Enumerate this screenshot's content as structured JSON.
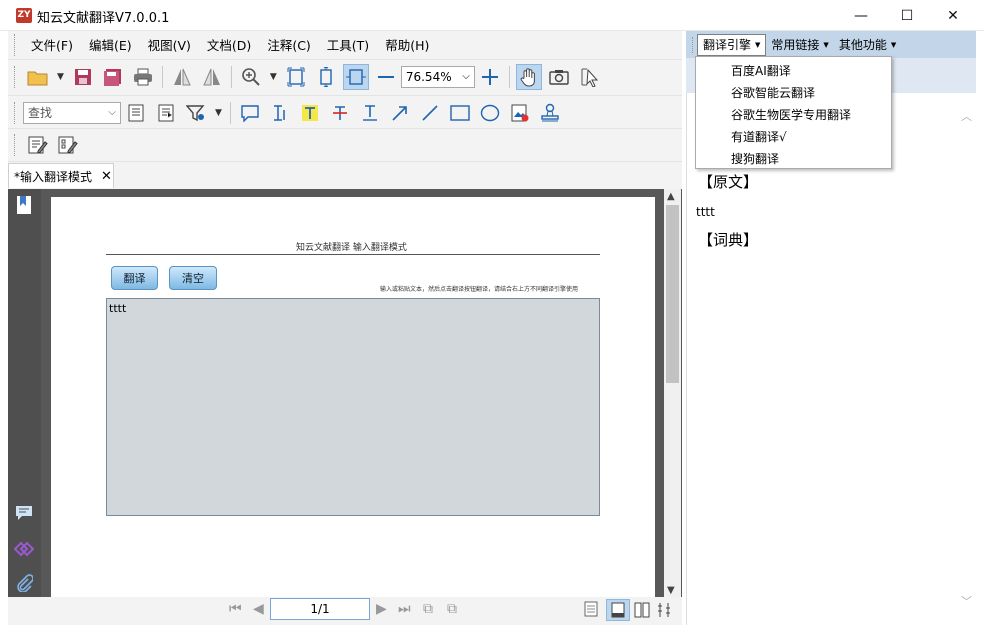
{
  "app": {
    "title": "知云文献翻译V7.0.0.1",
    "icon_text": "ZY"
  },
  "window": {
    "minimize": "—",
    "maximize": "☐",
    "close": "✕"
  },
  "menu": [
    "文件(F)",
    "编辑(E)",
    "视图(V)",
    "文档(D)",
    "注释(C)",
    "工具(T)",
    "帮助(H)"
  ],
  "toolbar": {
    "zoom_value": "76.54%",
    "search_placeholder": "查找"
  },
  "tab": {
    "label": "*输入翻译模式",
    "close": "✕"
  },
  "doc": {
    "title": "知云文献翻译  输入翻译模式",
    "translate_btn": "翻译",
    "clear_btn": "清空",
    "hint": "输入或粘贴文本，然后点击翻译按钮翻译，请结合右上方不同翻译引擎使用",
    "input_text": "tttt"
  },
  "pager": {
    "page": "1/1"
  },
  "right": {
    "menus": [
      "翻译引擎",
      "常用链接",
      "其他功能"
    ],
    "dropdown": [
      "百度AI翻译",
      "谷歌智能云翻译",
      "谷歌生物医学专用翻译",
      "有道翻译√",
      "搜狗翻译"
    ],
    "section_original": "【原文】",
    "original_text": "tttt",
    "section_dict": "【词典】"
  }
}
